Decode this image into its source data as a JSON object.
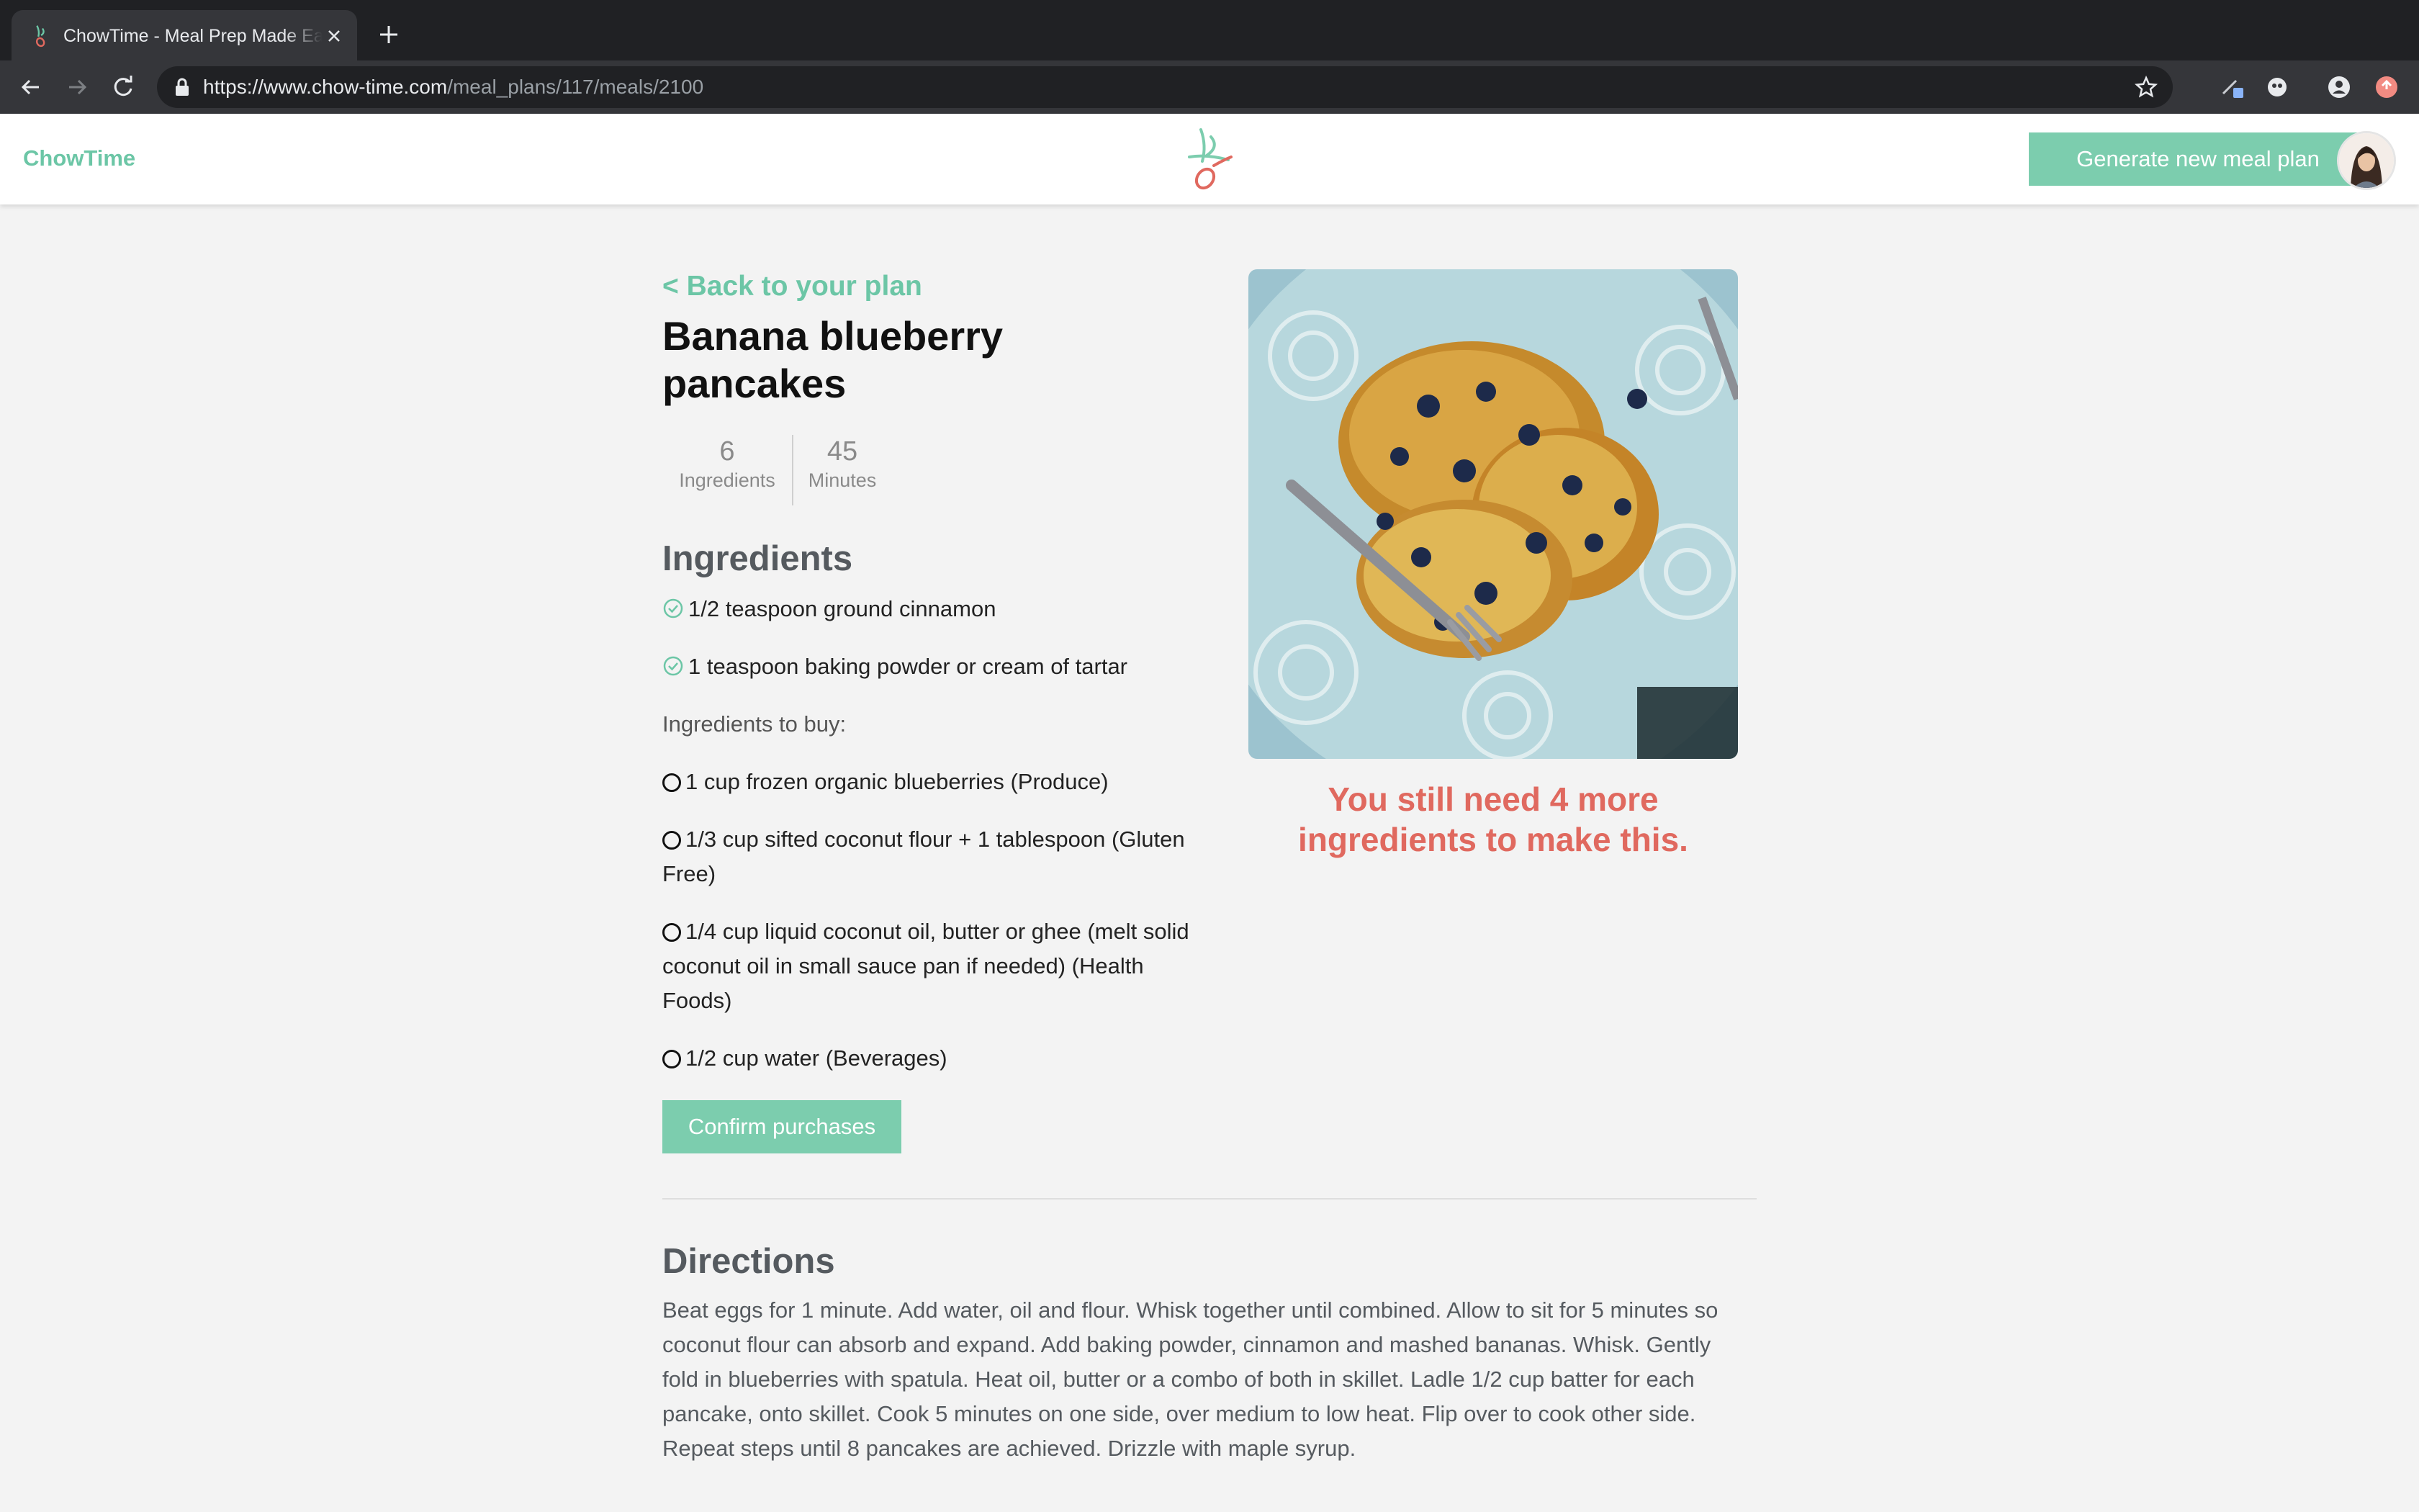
{
  "browser": {
    "tab_title": "ChowTime - Meal Prep Made Easy",
    "url_host": "https://www.chow-time.com",
    "url_path": "/meal_plans/117/meals/2100"
  },
  "header": {
    "brand": "ChowTime",
    "generate_label": "Generate new meal plan"
  },
  "meal": {
    "back_label": "< Back to your plan",
    "title": "Banana blueberry pancakes",
    "ingredients_count": "6",
    "ingredients_label": "Ingredients",
    "minutes": "45",
    "minutes_label": "Minutes",
    "still_need": "You still need 4 more ingredients to make this."
  },
  "ingredients": {
    "heading": "Ingredients",
    "have": [
      "1/2 teaspoon ground cinnamon",
      "1 teaspoon baking powder or cream of tartar"
    ],
    "to_buy_label": "Ingredients to buy:",
    "to_buy": [
      "1 cup frozen organic blueberries (Produce)",
      "1/3 cup sifted coconut flour + 1 tablespoon (Gluten Free)",
      "1/4 cup liquid coconut oil, butter or ghee (melt solid coconut oil in small sauce pan if needed) (Health Foods)",
      "1/2 cup water (Beverages)"
    ],
    "confirm_label": "Confirm purchases"
  },
  "directions": {
    "heading": "Directions",
    "text": "Beat eggs for 1 minute. Add water, oil and flour. Whisk together until combined. Allow to sit for 5 minutes so coconut flour can absorb and expand. Add baking powder, cinnamon and mashed bananas. Whisk. Gently fold in blueberries with spatula. Heat oil, butter or a combo of both in skillet. Ladle 1/2 cup batter for each pancake, onto skillet. Cook 5 minutes on one side, over medium to low heat. Flip over to cook other side. Repeat steps until 8 pancakes are achieved. Drizzle with maple syrup."
  },
  "colors": {
    "accent_green": "#7ccdae",
    "alert_red": "#e0695f"
  },
  "icons": {
    "check": "check-circle-icon",
    "unchecked": "empty-circle-icon"
  }
}
